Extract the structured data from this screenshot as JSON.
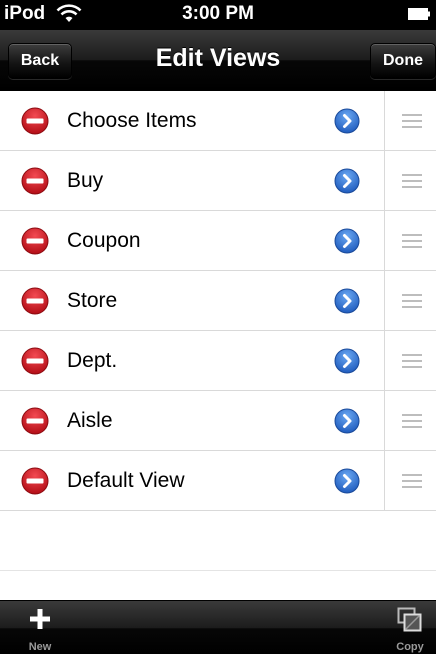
{
  "status_bar": {
    "device": "iPod",
    "time": "3:00 PM",
    "icons": [
      "wifi-icon",
      "battery-icon"
    ]
  },
  "nav": {
    "back_label": "Back",
    "title": "Edit Views",
    "done_label": "Done"
  },
  "rows": [
    {
      "label": "Choose Items"
    },
    {
      "label": "Buy"
    },
    {
      "label": "Coupon"
    },
    {
      "label": "Store"
    },
    {
      "label": "Dept."
    },
    {
      "label": "Aisle"
    },
    {
      "label": "Default View"
    }
  ],
  "row_icons": [
    "delete-icon",
    "disclosure-icon",
    "reorder-icon"
  ],
  "toolbar": {
    "new_label": "New",
    "copy_label": "Copy"
  },
  "colors": {
    "delete_red": "#c8101e",
    "disclosure_blue": "#2f6fd0",
    "bar_black": "#000000"
  }
}
